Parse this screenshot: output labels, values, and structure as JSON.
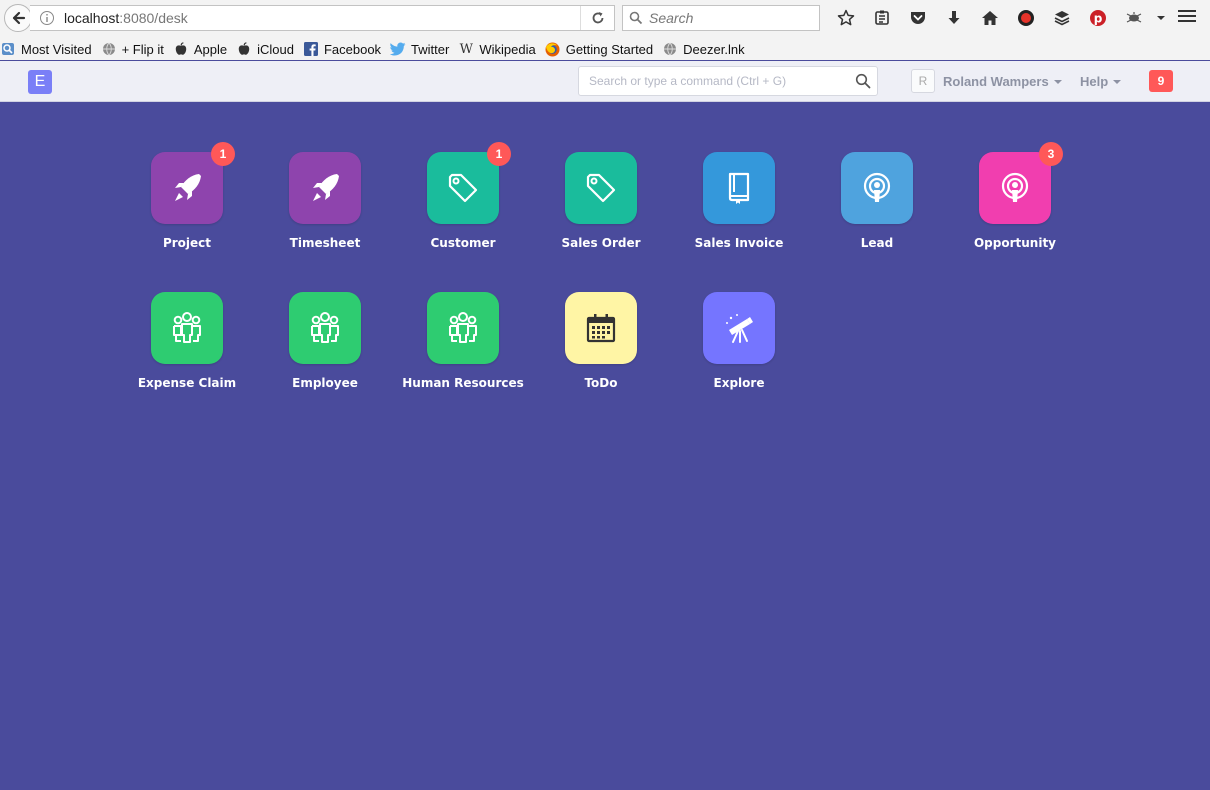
{
  "browser": {
    "url_host": "localhost",
    "url_path": ":8080/desk",
    "search_placeholder": "Search",
    "toolbar_icons": [
      "star-icon",
      "reading-list-icon",
      "pocket-icon",
      "download-icon",
      "home-icon",
      "extension-red-icon",
      "buffer-icon",
      "pinterest-icon",
      "extension-bug-icon",
      "dropdown-icon"
    ],
    "bookmarks": [
      {
        "label": "Most Visited",
        "icon": "most-visited-icon"
      },
      {
        "label": "+ Flip it",
        "icon": "globe-icon"
      },
      {
        "label": "Apple",
        "icon": "apple-icon"
      },
      {
        "label": "iCloud",
        "icon": "apple-icon"
      },
      {
        "label": "Facebook",
        "icon": "facebook-icon"
      },
      {
        "label": "Twitter",
        "icon": "twitter-icon"
      },
      {
        "label": "Wikipedia",
        "icon": "wikipedia-icon"
      },
      {
        "label": "Getting Started",
        "icon": "firefox-icon"
      },
      {
        "label": "Deezer.lnk",
        "icon": "globe-icon"
      }
    ]
  },
  "navbar": {
    "logo_letter": "E",
    "search_placeholder": "Search or type a command (Ctrl + G)",
    "user_initial": "R",
    "user_name": "Roland Wampers",
    "help_label": "Help",
    "notification_count": "9"
  },
  "desktop": {
    "row1": [
      {
        "label": "Project",
        "color": "#8e44ad",
        "icon": "rocket-icon",
        "badge": "1"
      },
      {
        "label": "Timesheet",
        "color": "#8e44ad",
        "icon": "rocket-icon",
        "badge": ""
      },
      {
        "label": "Customer",
        "color": "#1abc9c",
        "icon": "tag-icon",
        "badge": "1"
      },
      {
        "label": "Sales Order",
        "color": "#1abc9c",
        "icon": "tag-icon",
        "badge": ""
      },
      {
        "label": "Sales Invoice",
        "color": "#3498db",
        "icon": "book-icon",
        "badge": ""
      },
      {
        "label": "Lead",
        "color": "#4fa3de",
        "icon": "broadcast-icon",
        "badge": ""
      },
      {
        "label": "Opportunity",
        "color": "#f13eaf",
        "icon": "broadcast-icon",
        "badge": "3"
      }
    ],
    "row2": [
      {
        "label": "Expense Claim",
        "color": "#2ecc71",
        "icon": "people-icon",
        "badge": ""
      },
      {
        "label": "Employee",
        "color": "#2ecc71",
        "icon": "people-icon",
        "badge": ""
      },
      {
        "label": "Human Resources",
        "color": "#2ecc71",
        "icon": "people-icon",
        "badge": ""
      },
      {
        "label": "ToDo",
        "color": "#fff5a5",
        "icon": "calendar-icon",
        "badge": ""
      },
      {
        "label": "Explore",
        "color": "#7575ff",
        "icon": "telescope-icon",
        "badge": ""
      }
    ]
  }
}
